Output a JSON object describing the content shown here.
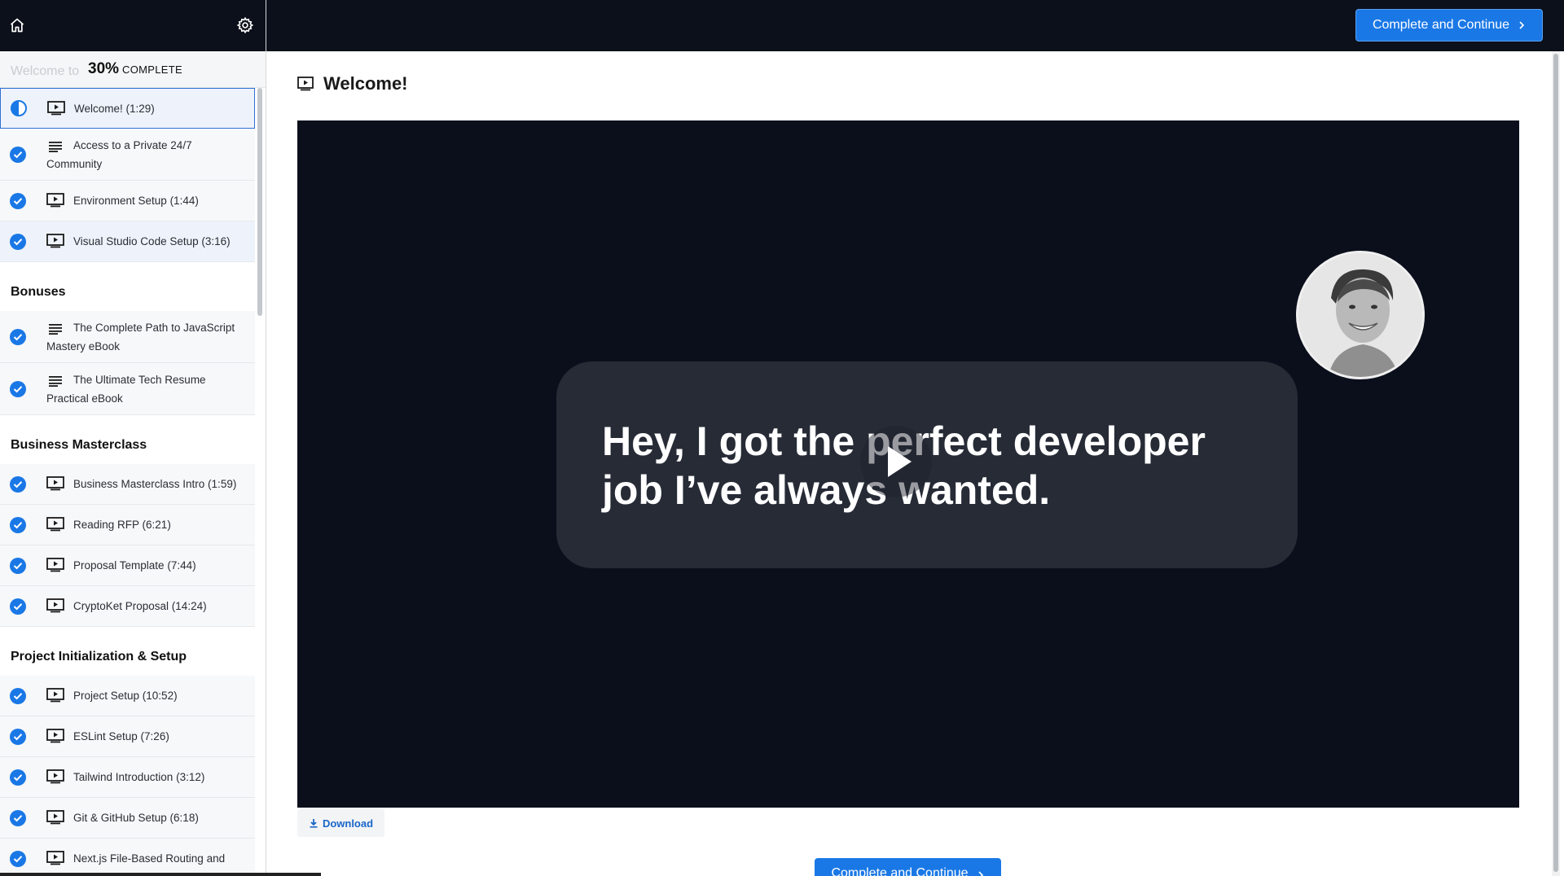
{
  "sidebar": {
    "progress_ghost": "Welcome to",
    "progress_percent": "30%",
    "progress_label": "COMPLETE",
    "progress_value": 0.3,
    "top_sections": [
      {
        "title": "",
        "lessons": [
          {
            "title": "Welcome! (1:29)",
            "type": "video-icon",
            "status": "in-progress",
            "current": true
          },
          {
            "title": "Access to a Private 24/7 Community",
            "type": "text-icon",
            "status": "complete"
          },
          {
            "title": "Environment Setup (1:44)",
            "type": "video-icon",
            "status": "complete"
          },
          {
            "title": "Visual Studio Code Setup (3:16)",
            "type": "video-icon",
            "status": "complete",
            "highlight": true
          }
        ]
      },
      {
        "title": "Bonuses",
        "lessons": [
          {
            "title": "The Complete Path to JavaScript Mastery eBook",
            "type": "text-icon",
            "status": "complete"
          },
          {
            "title": "The Ultimate Tech Resume Practical eBook",
            "type": "text-icon",
            "status": "complete"
          }
        ]
      },
      {
        "title": "Business Masterclass",
        "lessons": [
          {
            "title": "Business Masterclass Intro (1:59)",
            "type": "video-icon",
            "status": "complete"
          },
          {
            "title": "Reading RFP (6:21)",
            "type": "video-icon",
            "status": "complete"
          },
          {
            "title": "Proposal Template (7:44)",
            "type": "video-icon",
            "status": "complete"
          },
          {
            "title": "CryptoKet Proposal (14:24)",
            "type": "video-icon",
            "status": "complete"
          }
        ]
      },
      {
        "title": "Project Initialization & Setup",
        "lessons": [
          {
            "title": "Project Setup (10:52)",
            "type": "video-icon",
            "status": "complete"
          },
          {
            "title": "ESLint Setup (7:26)",
            "type": "video-icon",
            "status": "complete"
          },
          {
            "title": "Tailwind Introduction (3:12)",
            "type": "video-icon",
            "status": "complete"
          },
          {
            "title": "Git & GitHub Setup (6:18)",
            "type": "video-icon",
            "status": "complete"
          },
          {
            "title": "Next.js File-Based Routing and",
            "type": "video-icon",
            "status": "complete"
          }
        ]
      }
    ]
  },
  "toolbar": {
    "complete_label": "Complete and Continue"
  },
  "lecture": {
    "title": "Welcome!",
    "caption": "Hey, I got the perfect developer job I’ve always wanted.",
    "download_label": "Download"
  },
  "footer": {
    "complete_label": "Complete and Continue"
  },
  "colors": {
    "accent": "#1a78e6",
    "dark_bar": "#0c101a",
    "video_bg": "#0b0f1c"
  }
}
